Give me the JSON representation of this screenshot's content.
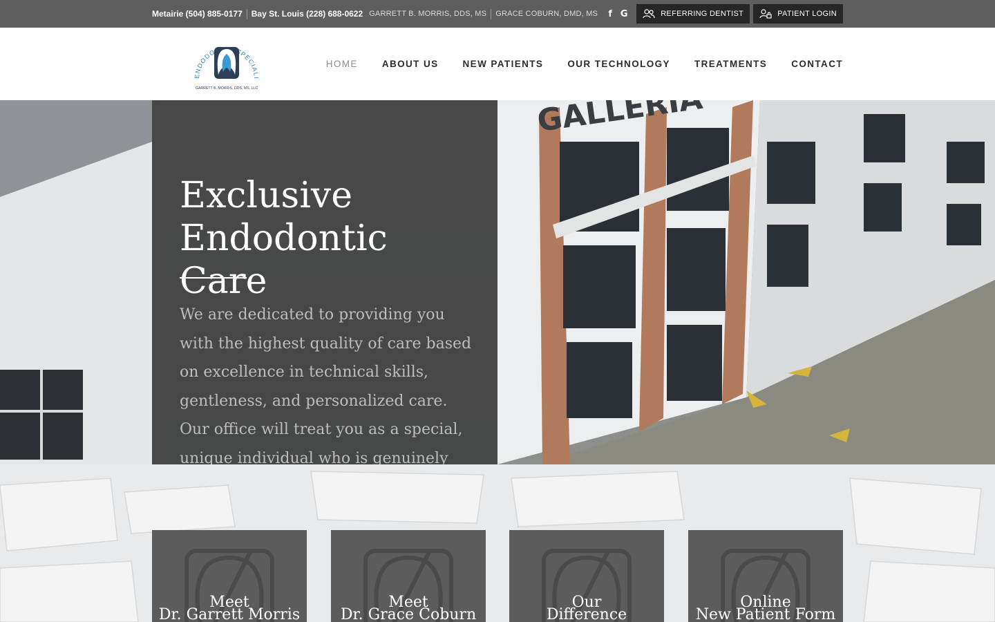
{
  "topbar": {
    "phone_metairie": "Metairie (504) 885-0177",
    "phone_bay": "Bay St. Louis (228) 688-0622",
    "doctor_1": "GARRETT B. MORRIS, DDS, MS",
    "doctor_2": "GRACE COBURN, DMD, MS",
    "social": [
      {
        "icon": "facebook-icon",
        "glyph": "f"
      },
      {
        "icon": "google-icon",
        "glyph": "G"
      }
    ],
    "referring_dentist": "REFERRING DENTIST",
    "patient_login": "PATIENT LOGIN"
  },
  "logo": {
    "arc_text": "ENDODONTIC SPECIALISTS",
    "sub_text": "GARRETT B. MORRIS, DDS, MS, LLC"
  },
  "nav": {
    "items": [
      {
        "label": "HOME",
        "active": true
      },
      {
        "label": "ABOUT US",
        "active": false
      },
      {
        "label": "NEW PATIENTS",
        "active": false
      },
      {
        "label": "OUR TECHNOLOGY",
        "active": false
      },
      {
        "label": "TREATMENTS",
        "active": false
      },
      {
        "label": "CONTACT",
        "active": false
      }
    ]
  },
  "hero": {
    "title": "Exclusive Endodontic Care",
    "body": "We are dedicated to providing you with the highest quality of care based on excellence in technical skills, gentleness, and personalized care. Our office will treat you as a special, unique individual who is genuinely",
    "building_sign": "GALLERIA"
  },
  "cards": [
    {
      "line1": "Meet",
      "line2": "Dr. Garrett Morris"
    },
    {
      "line1": "Meet",
      "line2": "Dr. Grace Coburn"
    },
    {
      "line1": "Our",
      "line2": "Difference"
    },
    {
      "line1": "Online",
      "line2": "New Patient Form"
    }
  ],
  "colors": {
    "topbar": "#5e5e5e",
    "button_dark": "#262626",
    "panel": "#404040",
    "card": "#5c5c5c",
    "logo_blue": "#2e7fb8"
  }
}
